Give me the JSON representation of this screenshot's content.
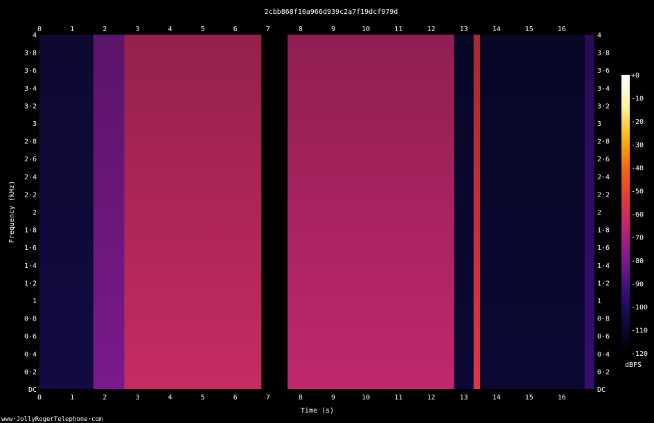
{
  "chart_data": {
    "type": "heatmap",
    "title": "2cbb868f10a966d939c2a7f19dcf979d",
    "xlabel": "Time (s)",
    "ylabel": "Frequency (kHz)",
    "xlim": [
      0,
      17
    ],
    "ylim": [
      0,
      4
    ],
    "x_ticks": [
      {
        "value": 0,
        "label": "0"
      },
      {
        "value": 1,
        "label": "1"
      },
      {
        "value": 2,
        "label": "2"
      },
      {
        "value": 3,
        "label": "3"
      },
      {
        "value": 4,
        "label": "4"
      },
      {
        "value": 5,
        "label": "5"
      },
      {
        "value": 6,
        "label": "6"
      },
      {
        "value": 7,
        "label": "7"
      },
      {
        "value": 8,
        "label": "8"
      },
      {
        "value": 9,
        "label": "9"
      },
      {
        "value": 10,
        "label": "10"
      },
      {
        "value": 11,
        "label": "11"
      },
      {
        "value": 12,
        "label": "12"
      },
      {
        "value": 13,
        "label": "13"
      },
      {
        "value": 14,
        "label": "14"
      },
      {
        "value": 15,
        "label": "15"
      },
      {
        "value": 16,
        "label": "16"
      }
    ],
    "y_ticks": [
      {
        "value": 0,
        "label": "DC"
      },
      {
        "value": 0.2,
        "label": "0·2"
      },
      {
        "value": 0.4,
        "label": "0·4"
      },
      {
        "value": 0.6,
        "label": "0·6"
      },
      {
        "value": 0.8,
        "label": "0·8"
      },
      {
        "value": 1.0,
        "label": "1"
      },
      {
        "value": 1.2,
        "label": "1·2"
      },
      {
        "value": 1.4,
        "label": "1·4"
      },
      {
        "value": 1.6,
        "label": "1·6"
      },
      {
        "value": 1.8,
        "label": "1·8"
      },
      {
        "value": 2.0,
        "label": "2"
      },
      {
        "value": 2.2,
        "label": "2·2"
      },
      {
        "value": 2.4,
        "label": "2·4"
      },
      {
        "value": 2.6,
        "label": "2·6"
      },
      {
        "value": 2.8,
        "label": "2·8"
      },
      {
        "value": 3.0,
        "label": "3"
      },
      {
        "value": 3.2,
        "label": "3·2"
      },
      {
        "value": 3.4,
        "label": "3·4"
      },
      {
        "value": 3.6,
        "label": "3·6"
      },
      {
        "value": 3.8,
        "label": "3·8"
      },
      {
        "value": 4.0,
        "label": "4"
      }
    ],
    "colorbar": {
      "unit": "dBFS",
      "range": [
        -120,
        0
      ],
      "ticks": [
        {
          "value": 0,
          "label": "+0"
        },
        {
          "value": -10,
          "label": "-10"
        },
        {
          "value": -20,
          "label": "-20"
        },
        {
          "value": -30,
          "label": "-30"
        },
        {
          "value": -40,
          "label": "-40"
        },
        {
          "value": -50,
          "label": "-50"
        },
        {
          "value": -60,
          "label": "-60"
        },
        {
          "value": -70,
          "label": "-70"
        },
        {
          "value": -80,
          "label": "-80"
        },
        {
          "value": -90,
          "label": "-90"
        },
        {
          "value": -100,
          "label": "-100"
        },
        {
          "value": -110,
          "label": "-110"
        },
        {
          "value": -120,
          "label": "-120"
        }
      ],
      "colors": [
        "#000000",
        "#0c0a3a",
        "#3a0f78",
        "#7a1a8c",
        "#b7237a",
        "#e23a3a",
        "#f26a10",
        "#fbb812",
        "#fff4a0",
        "#ffffff"
      ]
    },
    "segments": [
      {
        "start": 0.0,
        "end": 1.65,
        "level_dbfs": -105
      },
      {
        "start": 1.65,
        "end": 2.6,
        "level_dbfs": -80
      },
      {
        "start": 2.6,
        "end": 6.8,
        "level_dbfs": -62
      },
      {
        "start": 6.8,
        "end": 7.6,
        "level_dbfs": -120
      },
      {
        "start": 7.6,
        "end": 12.7,
        "level_dbfs": -64
      },
      {
        "start": 12.7,
        "end": 13.3,
        "level_dbfs": -108
      },
      {
        "start": 13.3,
        "end": 13.5,
        "level_dbfs": -55
      },
      {
        "start": 13.5,
        "end": 16.7,
        "level_dbfs": -108
      },
      {
        "start": 16.7,
        "end": 17.0,
        "level_dbfs": -95
      }
    ]
  },
  "footer": "www·JollyRogerTelephone·com"
}
